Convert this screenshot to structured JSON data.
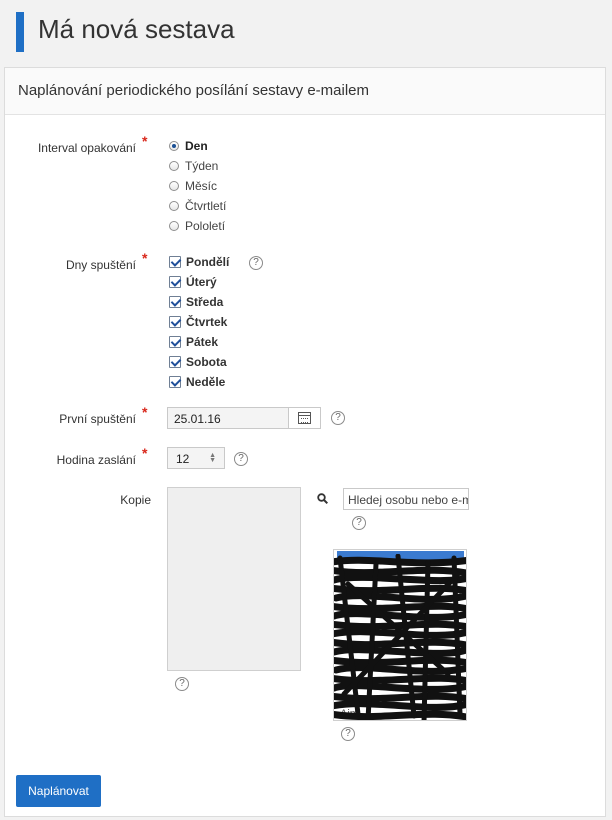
{
  "page": {
    "title": "Má nová sestava"
  },
  "panel": {
    "heading": "Naplánování periodického posílání sestavy e-mailem"
  },
  "form": {
    "interval": {
      "label": "Interval opakování",
      "options": [
        {
          "label": "Den",
          "selected": true
        },
        {
          "label": "Týden",
          "selected": false
        },
        {
          "label": "Měsíc",
          "selected": false
        },
        {
          "label": "Čtvrtletí",
          "selected": false
        },
        {
          "label": "Pololetí",
          "selected": false
        }
      ]
    },
    "days": {
      "label": "Dny spuštění",
      "options": [
        {
          "label": "Pondělí",
          "checked": true
        },
        {
          "label": "Úterý",
          "checked": true
        },
        {
          "label": "Středa",
          "checked": true
        },
        {
          "label": "Čtvrtek",
          "checked": true
        },
        {
          "label": "Pátek",
          "checked": true
        },
        {
          "label": "Sobota",
          "checked": true
        },
        {
          "label": "Neděle",
          "checked": true
        }
      ]
    },
    "first_run": {
      "label": "První spuštění",
      "value": "25.01.16"
    },
    "send_hour": {
      "label": "Hodina zaslání",
      "value": "12"
    },
    "copy": {
      "label": "Kopie",
      "search_placeholder": "Hledej osobu nebo e-mail",
      "results_fragments": [
        "s@",
        "ik",
        "Aim"
      ]
    },
    "required_mark": "*",
    "help_glyph": "?"
  },
  "actions": {
    "submit_label": "Naplánovat"
  },
  "colors": {
    "accent": "#1f6fc5",
    "required": "#d9281c"
  }
}
